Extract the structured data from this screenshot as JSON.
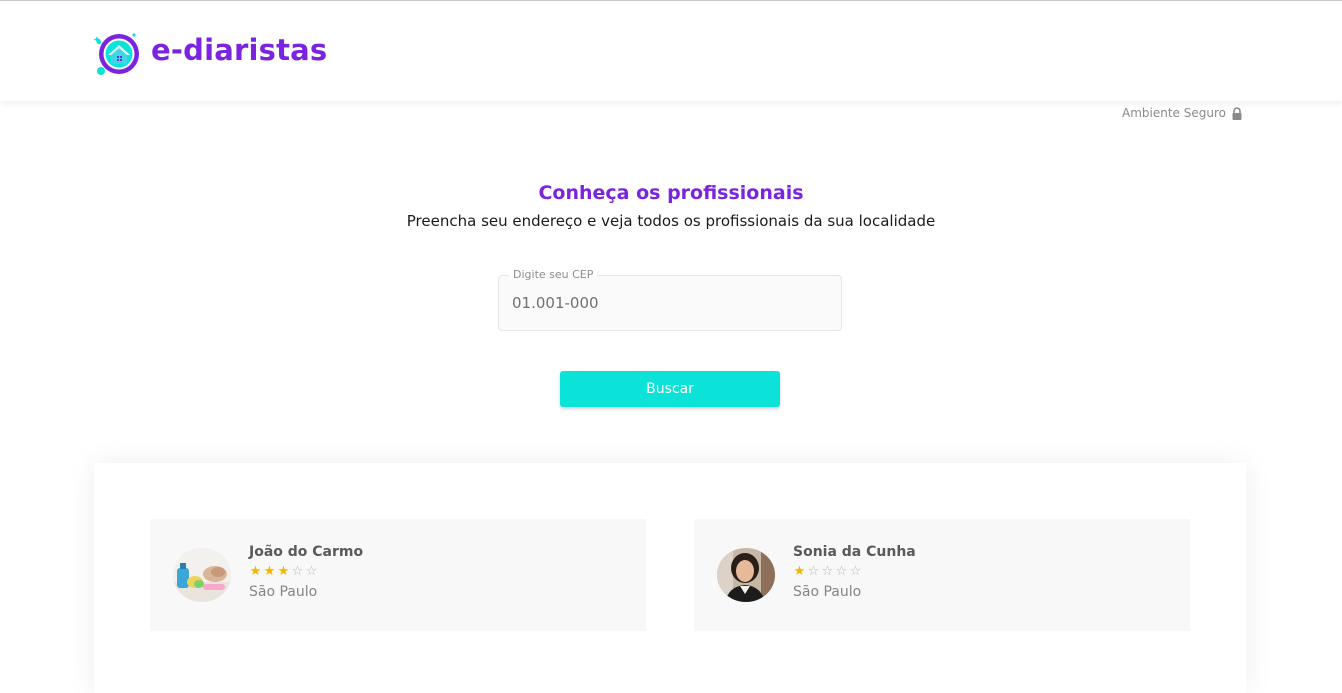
{
  "header": {
    "brand_name": "e-diaristas",
    "secure_label": "Ambiente Seguro"
  },
  "hero": {
    "title": "Conheça os profissionais",
    "subtitle": "Preencha seu endereço e veja todos os profissionais da sua localidade"
  },
  "search": {
    "cep_label": "Digite seu CEP",
    "cep_placeholder": "01.001-000",
    "cep_value": "",
    "button_label": "Buscar"
  },
  "professionals": [
    {
      "name": "João do Carmo",
      "rating": 3,
      "max_rating": 5,
      "city": "São Paulo"
    },
    {
      "name": "Sonia da Cunha",
      "rating": 1,
      "max_rating": 5,
      "city": "São Paulo"
    }
  ],
  "colors": {
    "brand_purple": "#7b24e0",
    "accent_cyan": "#0ce3d8",
    "star_gold": "#f5b400"
  },
  "icons": {
    "logo": "house-cleaning-logo-icon",
    "lock": "lock-icon",
    "star_full": "star-filled-icon",
    "star_empty": "star-outline-icon"
  }
}
